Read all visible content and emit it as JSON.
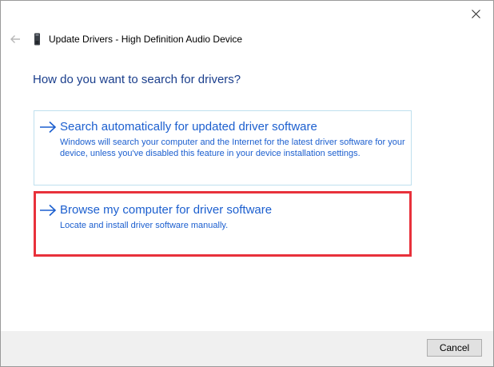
{
  "window": {
    "title": "Update Drivers - High Definition Audio Device"
  },
  "heading": "How do you want to search for drivers?",
  "options": [
    {
      "title": "Search automatically for updated driver software",
      "description": "Windows will search your computer and the Internet for the latest driver software for your device, unless you've disabled this feature in your device installation settings.",
      "icon": "arrow-right-icon",
      "highlighted": false
    },
    {
      "title": "Browse my computer for driver software",
      "description": "Locate and install driver software manually.",
      "icon": "arrow-right-icon",
      "highlighted": true
    }
  ],
  "footer": {
    "cancel_label": "Cancel"
  },
  "icons": {
    "close": "close-icon",
    "back": "back-arrow-icon",
    "device": "device-icon"
  },
  "colors": {
    "heading": "#1a3e8c",
    "link": "#1c5fcf",
    "highlight_border": "#e8313b",
    "option_border": "#bfe0ee",
    "footer_bg": "#f0f0f0"
  }
}
